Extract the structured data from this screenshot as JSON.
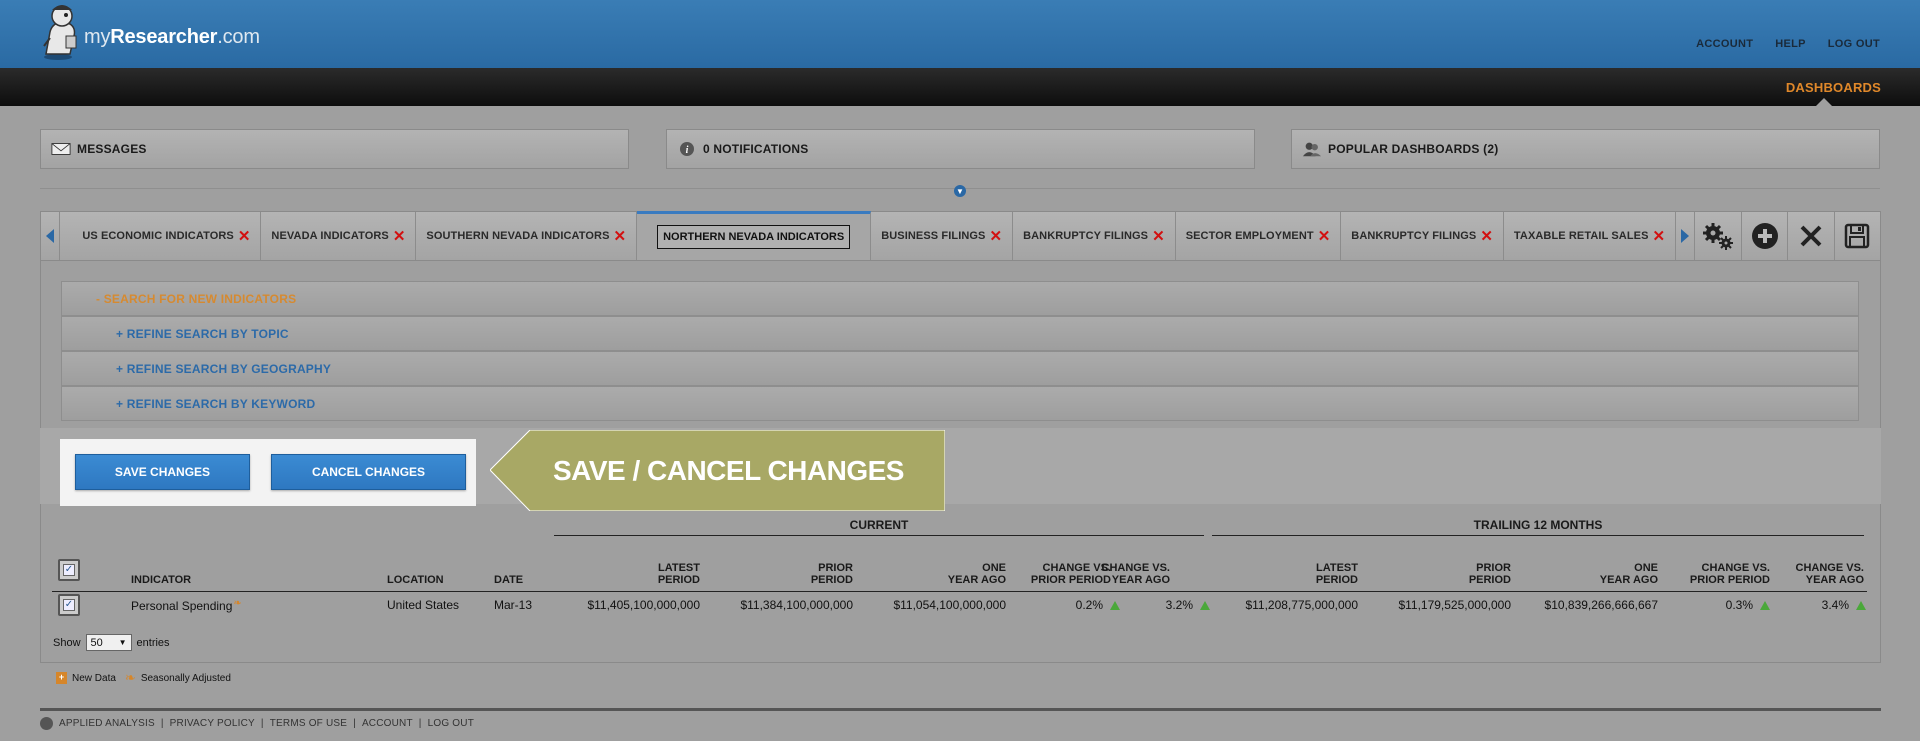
{
  "header": {
    "logo_prefix": "my",
    "logo_bold": "Researcher",
    "logo_suffix": ".com",
    "links": [
      "ACCOUNT",
      "HELP",
      "LOG OUT"
    ]
  },
  "nav": {
    "active": "DASHBOARDS"
  },
  "panels": {
    "messages": "MESSAGES",
    "notifications": "0 NOTIFICATIONS",
    "popular": "POPULAR DASHBOARDS (2)"
  },
  "tabs": [
    {
      "label": "US ECONOMIC INDICATORS"
    },
    {
      "label": "NEVADA INDICATORS"
    },
    {
      "label": "SOUTHERN NEVADA INDICATORS"
    },
    {
      "label": "NORTHERN NEVADA INDICATORS",
      "active": true
    },
    {
      "label": "BUSINESS FILINGS"
    },
    {
      "label": "BANKRUPTCY FILINGS"
    },
    {
      "label": "SECTOR EMPLOYMENT"
    },
    {
      "label": "BANKRUPTCY FILINGS"
    },
    {
      "label": "TAXABLE RETAIL SALES"
    }
  ],
  "search": {
    "main": "- SEARCH FOR NEW INDICATORS",
    "topic": "+ REFINE SEARCH BY TOPIC",
    "geo": "+ REFINE SEARCH BY GEOGRAPHY",
    "keyword": "+ REFINE SEARCH BY KEYWORD"
  },
  "buttons": {
    "save": "SAVE CHANGES",
    "cancel": "CANCEL CHANGES"
  },
  "callout": "SAVE / CANCEL CHANGES",
  "table": {
    "group_current": "CURRENT",
    "group_trailing": "TRAILING 12 MONTHS",
    "headers": {
      "indicator": "INDICATOR",
      "location": "LOCATION",
      "date": "DATE",
      "latest1": "LATEST",
      "latest2": "PERIOD",
      "prior1": "PRIOR",
      "prior2": "PERIOD",
      "oya1": "ONE",
      "oya2": "YEAR AGO",
      "cvpp1": "CHANGE VS.",
      "cvpp2": "PRIOR PERIOD",
      "cvya1": "CHANGE VS.",
      "cvya2": "YEAR AGO"
    },
    "row": {
      "indicator": "Personal Spending",
      "location": "United States",
      "date": "Mar-13",
      "cur_latest": "$11,405,100,000,000",
      "cur_prior": "$11,384,100,000,000",
      "cur_oya": "$11,054,100,000,000",
      "cur_cvpp": "0.2%",
      "cur_cvya": "3.2%",
      "tr_latest": "$11,208,775,000,000",
      "tr_prior": "$11,179,525,000,000",
      "tr_oya": "$10,839,266,666,667",
      "tr_cvpp": "0.3%",
      "tr_cvya": "3.4%"
    }
  },
  "show": {
    "prefix": "Show",
    "value": "50",
    "suffix": "entries"
  },
  "legend": {
    "new": "New Data",
    "seasonal": "Seasonally Adjusted"
  },
  "footer": {
    "items": [
      "APPLIED ANALYSIS",
      "PRIVACY POLICY",
      "TERMS OF USE",
      "ACCOUNT",
      "LOG OUT"
    ]
  },
  "colors": {
    "header": "#2e6fa8",
    "accent": "#e0882a",
    "button": "#3282c9",
    "callout": "#a8a865",
    "up": "#4aa83a",
    "close": "#d21010"
  }
}
